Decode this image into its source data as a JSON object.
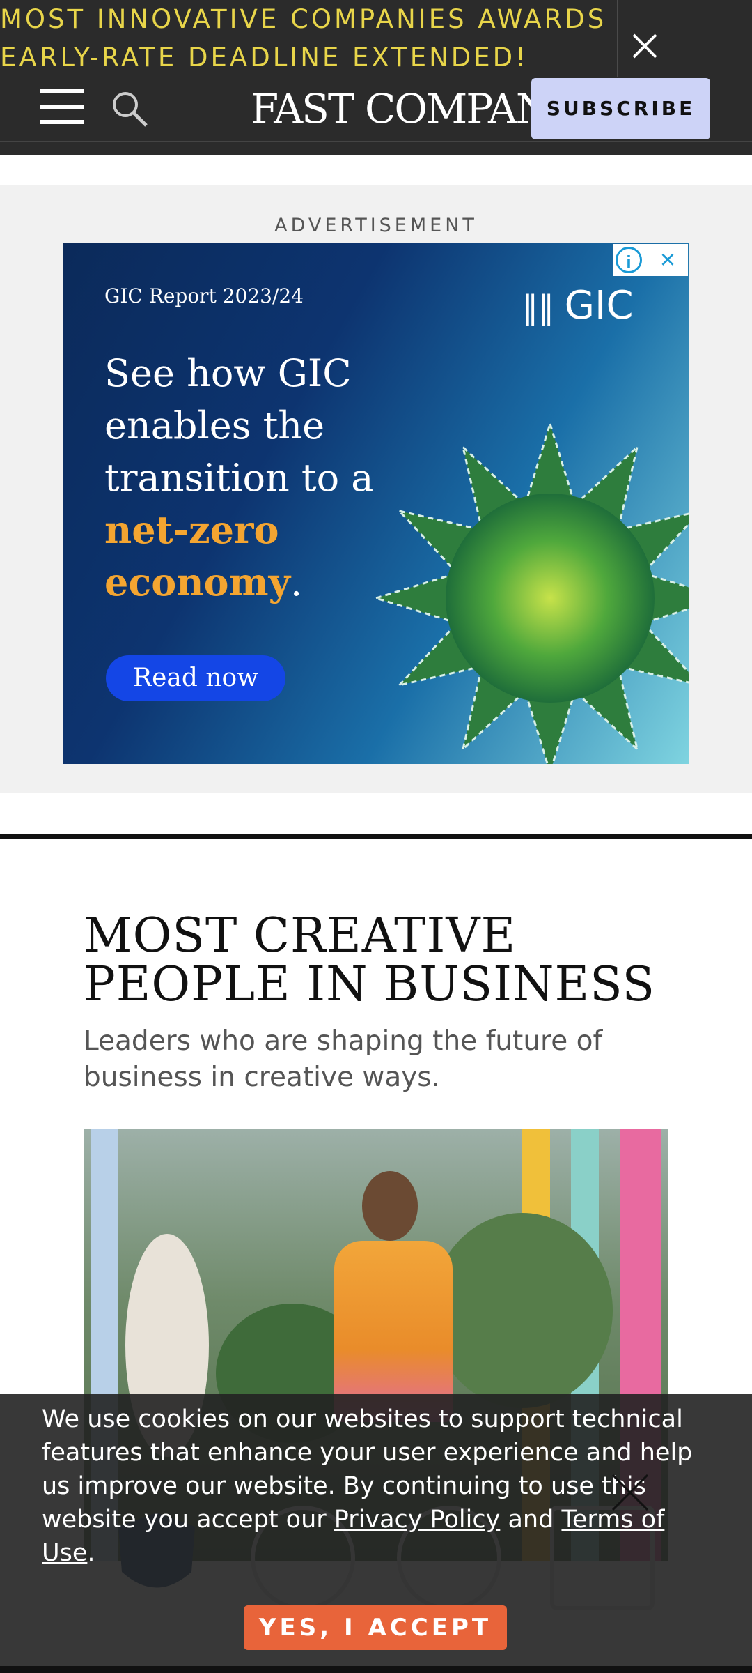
{
  "alert_banner": {
    "text": "MOST INNOVATIVE COMPANIES AWARDS EARLY-RATE DEADLINE EXTENDED!",
    "close_icon": "close-icon"
  },
  "header": {
    "menu_icon": "hamburger-menu-icon",
    "search_icon": "search-icon",
    "logo_text": "FAST COMPANY",
    "subscribe_label": "SUBSCRIBE"
  },
  "advertisement": {
    "label": "ADVERTISEMENT",
    "report_label": "GIC Report 2023/24",
    "brand": "GIC",
    "headline_part1": "See how GIC enables the transition to a",
    "headline_highlight": "net-zero economy",
    "headline_end": ".",
    "cta": "Read now",
    "info_icon": "info-icon",
    "close_icon": "close-icon"
  },
  "section": {
    "title": "MOST CREATIVE PEOPLE IN BUSINESS",
    "subtitle": "Leaders who are shaping the future of business in creative ways."
  },
  "cookie_banner": {
    "text_before": "We use cookies on our websites to support technical features that enhance your user experience and help us improve our website. By continuing to use this website you accept our ",
    "privacy_link": "Privacy Policy",
    "text_between": " and ",
    "terms_link": "Terms of Use",
    "text_after": ".",
    "accept_label": "YES, I ACCEPT"
  },
  "colors": {
    "alert_text": "#e8d54a",
    "subscribe_bg": "#cdd3f7",
    "accept_bg": "#e8643a",
    "ad_highlight": "#f4a531",
    "ad_cta_bg": "#1446e6"
  }
}
